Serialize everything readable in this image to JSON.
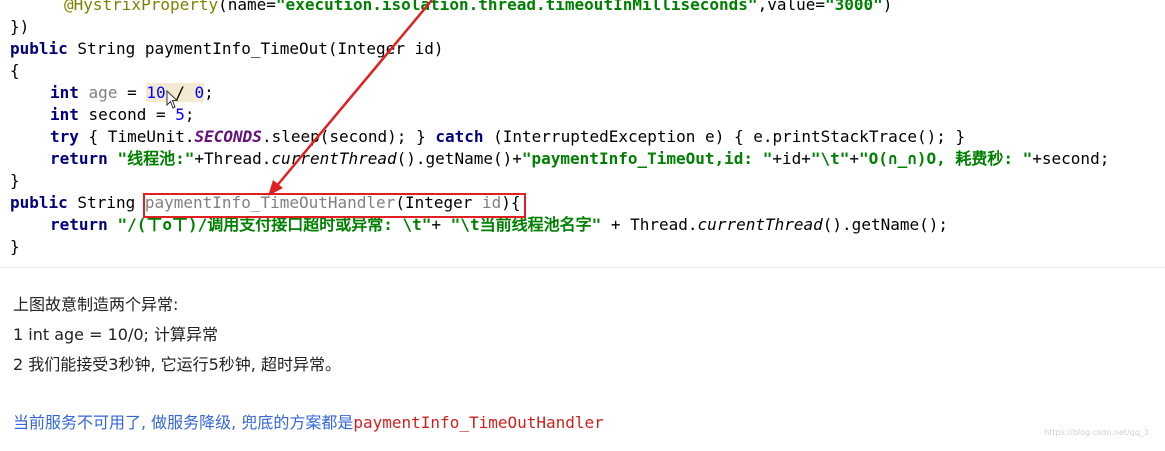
{
  "code": {
    "line0": {
      "annotation": "@HystrixProperty",
      "name_part": "(name=",
      "name_value": "\"execution.isolation.thread.timeoutInMilliseconds\"",
      "value_part": ",value=",
      "value_value": "\"3000\"",
      "close": ")"
    },
    "line1": "})",
    "line2": {
      "kw_public": "public",
      "signature": " String paymentInfo_TimeOut(Integer id)"
    },
    "line3": "{",
    "line4": {
      "kw_int": "int",
      "var_age": "age",
      "eq": " = ",
      "num_10": "10",
      "div": " / ",
      "num_0": "0",
      "semi": ";"
    },
    "line5": {
      "kw_int": "int",
      "rest": " second = ",
      "num_5": "5",
      "semi": ";"
    },
    "line6": {
      "kw_try": "try",
      "part1": " { TimeUnit.",
      "seconds": "SECONDS",
      "part2": ".sleep(second); } ",
      "kw_catch": "catch",
      "part3": " (InterruptedException e) { e.printStackTrace(); }"
    },
    "line7": {
      "kw_return": "return",
      "str1": "\"线程池:\"",
      "part1": "+Thread.",
      "current_thread": "currentThread",
      "part2": "().getName()+",
      "str2": "\"paymentInfo_TimeOut,id: \"",
      "part3": "+id+",
      "str3": "\"\\t\"",
      "part4": "+",
      "str4": "\"O(∩_∩)O, 耗费秒: \"",
      "part5": "+second;"
    },
    "line8": "}",
    "line9": {
      "kw_public": "public",
      "string_type": " String ",
      "handler_name": "paymentInfo_TimeOutHandler",
      "params_open": "(Integer ",
      "param_id": "id",
      "params_close": ")",
      "brace": "{"
    },
    "line10": {
      "kw_return": "return",
      "str1": "\"/(ㄒoㄒ)/调用支付接口超时或异常: \\t\"",
      "plus1": "+ ",
      "str2": "\"\\t当前线程池名字\"",
      "part2": " + Thread.",
      "current_thread": "currentThread",
      "part3": "().getName();"
    },
    "line11": "}"
  },
  "notes": {
    "intro": "上图故意制造两个异常:",
    "item1": "1  int age = 10/0; 计算异常",
    "item2": "2  我们能接受3秒钟, 它运行5秒钟, 超时异常。",
    "conclusion_text": "当前服务不可用了, 做服务降级, 兜底的方案都是",
    "conclusion_method": "paymentInfo_TimeOutHandler"
  },
  "watermark": "https://blog.csdn.net/qq_3",
  "colors": {
    "keyword": "#000080",
    "string": "#008000",
    "number": "#0000ff",
    "annotation_arrow": "#e02020",
    "note_blue": "#3467d9"
  },
  "icons": {
    "cursor": "mouse-cursor-icon",
    "arrow": "red-arrow-annotation"
  }
}
